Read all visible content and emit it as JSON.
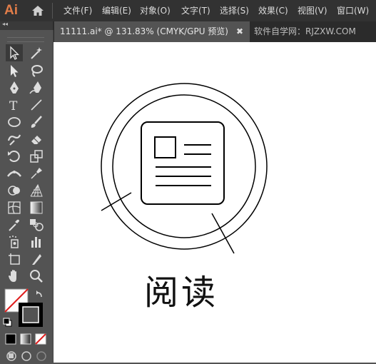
{
  "app": {
    "logo": "Ai"
  },
  "menu": [
    "文件(F)",
    "编辑(E)",
    "对象(O)",
    "文字(T)",
    "选择(S)",
    "效果(C)",
    "视图(V)",
    "窗口(W)"
  ],
  "document_tab": {
    "title": "11111.ai* @ 131.83% (CMYK/GPU 预览)",
    "close": "✖"
  },
  "second_tab": {
    "title": "软件自学网：RJZXW.COM"
  },
  "panel": {
    "collapse": "◂◂"
  },
  "tools": [
    "selection-tool",
    "magic-wand-tool",
    "direct-selection-tool",
    "lasso-tool",
    "pen-tool",
    "curvature-tool",
    "type-tool",
    "line-segment-tool",
    "ellipse-tool",
    "paintbrush-tool",
    "shaper-tool",
    "eraser-tool",
    "rotate-tool",
    "scale-tool",
    "width-tool",
    "puppet-warp-tool",
    "shape-builder-tool",
    "perspective-grid-tool",
    "mesh-tool",
    "gradient-tool",
    "eyedropper-tool",
    "blend-tool",
    "symbol-sprayer-tool",
    "column-graph-tool",
    "artboard-tool",
    "slice-tool",
    "hand-tool",
    "zoom-tool"
  ],
  "artwork": {
    "title": "阅读"
  },
  "colors": {
    "fill": "#ffffff",
    "stroke": "#000000",
    "none_slash": "#e02020",
    "accent": "#e27d49"
  }
}
